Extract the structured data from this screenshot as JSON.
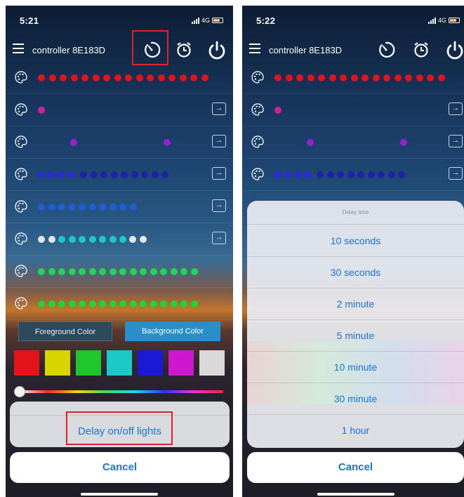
{
  "left": {
    "status": {
      "time": "5:21",
      "network": "4G"
    },
    "header": {
      "device_name": "controller 8E183D"
    },
    "bottom": {
      "fg_label": "Foreground Color",
      "bg_label": "Background Color",
      "action_label": "Delay on/off lights",
      "cancel_label": "Cancel"
    }
  },
  "right": {
    "status": {
      "time": "5:22",
      "network": "4G"
    },
    "header": {
      "device_name": "controller 8E183D"
    },
    "delay_sheet": {
      "title": "Delay time",
      "options": [
        "10 seconds",
        "30 seconds",
        "2 minute",
        "5 minute",
        "10 minute",
        "30 minute",
        "1 hour"
      ],
      "cancel_label": "Cancel"
    }
  },
  "colors": {
    "accent": "#1a73d9",
    "highlight": "#e0202a",
    "swatches": [
      "#e3121b",
      "#d7d400",
      "#1fc62c",
      "#1bc9c9",
      "#1a1ad6",
      "#cf17cf",
      "#d9d9d9"
    ]
  },
  "icons": [
    "menu-icon",
    "timer-icon",
    "alarm-clock-icon",
    "power-icon",
    "palette-icon",
    "arrow-right-icon"
  ]
}
